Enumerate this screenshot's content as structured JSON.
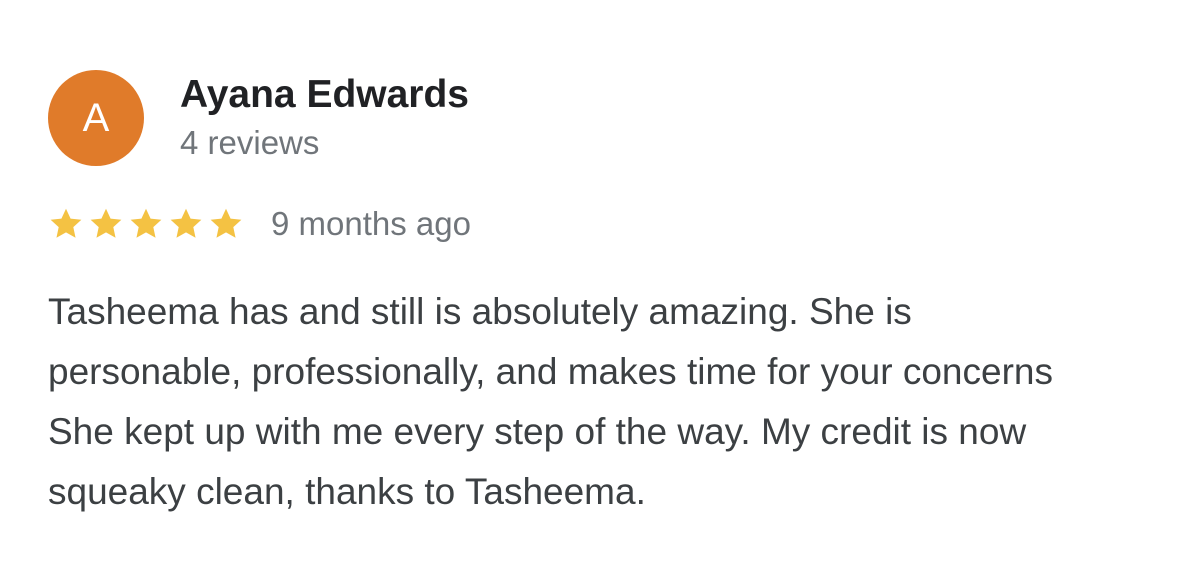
{
  "colors": {
    "avatar_background": "#e07b2a",
    "star": "#f4c243",
    "name_text": "#202124",
    "secondary_text": "#70757a",
    "body_text": "#3c4043"
  },
  "review": {
    "avatar_letter": "A",
    "author_name": "Ayana Edwards",
    "review_count": "4 reviews",
    "rating": 5,
    "rating_max": 5,
    "star_icon": "star-icon",
    "timestamp": "9 months ago",
    "text": "Tasheema has and still is absolutely amazing. She is\npersonable, professionally, and makes time for your concerns\nShe kept up with me every step of the way. My credit is now\nsqueaky clean, thanks to Tasheema."
  }
}
